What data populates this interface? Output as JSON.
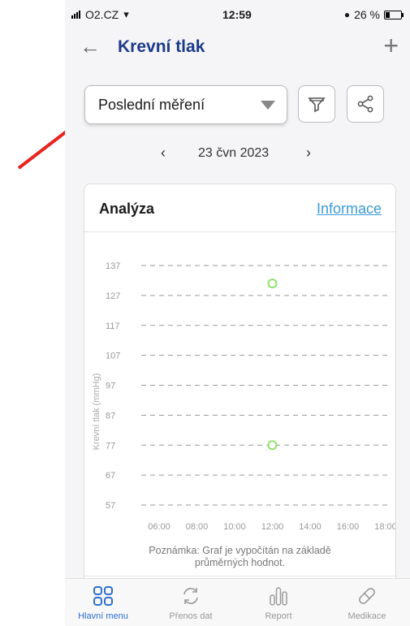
{
  "status": {
    "carrier": "O2.CZ",
    "time": "12:59",
    "battery": "26 %"
  },
  "header": {
    "title": "Krevní tlak"
  },
  "filter": {
    "selected": "Poslední měření"
  },
  "date_nav": {
    "date": "23 čvn 2023"
  },
  "analysis": {
    "title": "Analýza",
    "link": "Informace",
    "note_line1": "Poznámka: Graf je vypočítán na základě",
    "note_line2": "průměrných hodnot."
  },
  "chart_data": {
    "type": "scatter",
    "ylabel": "Krevní tlak (mmHg)",
    "y_ticks": [
      137,
      127,
      117,
      107,
      97,
      87,
      77,
      67,
      57
    ],
    "x_ticks": [
      "06:00",
      "08:00",
      "10:00",
      "12:00",
      "14:00",
      "16:00",
      "18:00"
    ],
    "ylim": [
      57,
      137
    ],
    "points": [
      {
        "x": "12:00",
        "y": 131
      },
      {
        "x": "12:00",
        "y": 77
      }
    ],
    "point_color": "#8ee36a",
    "grid": "dashed horizontal"
  },
  "tabs": [
    {
      "label": "Hlavní menu",
      "icon": "grid-icon",
      "active": true
    },
    {
      "label": "Přenos dat",
      "icon": "sync-icon",
      "active": false
    },
    {
      "label": "Report",
      "icon": "bars-icon",
      "active": false
    },
    {
      "label": "Medikace",
      "icon": "pill-icon",
      "active": false
    }
  ],
  "colors": {
    "accent": "#2d6fd1",
    "title": "#1c3a8a",
    "link": "#3b9bd9",
    "annotation_arrow": "#e8231d"
  }
}
